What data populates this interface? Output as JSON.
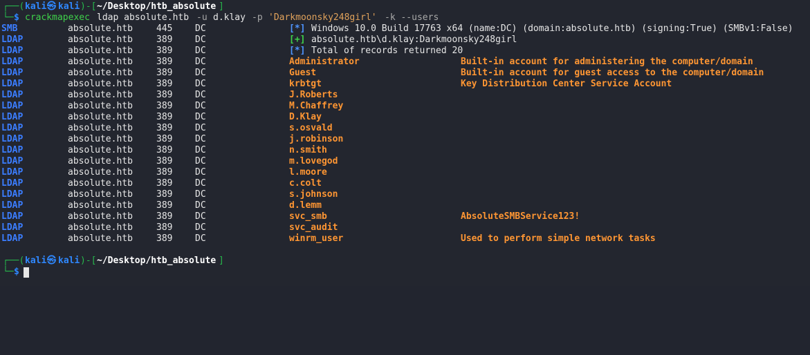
{
  "prompt": {
    "user": "kali",
    "at_symbol": "㉿",
    "host": "kali",
    "path": "~/Desktop/htb_absolute",
    "corner_top": "┌──(",
    "corner_bottom": "└─",
    "symbol": "$"
  },
  "command": {
    "program": "crackmapexec",
    "args_1": "ldap absolute.htb",
    "flag_u": "-u",
    "user_arg": "d.klay",
    "flag_p": "-p",
    "password_arg": "'Darkmoonsky248girl'",
    "flag_rest": "-k --users"
  },
  "output_rows": [
    {
      "proto": "SMB",
      "host": "absolute.htb",
      "port": "445",
      "name": "DC",
      "status": "[*]",
      "status_color": "blue",
      "message": "Windows 10.0 Build 17763 x64 (name:DC) (domain:absolute.htb) (signing:True) (SMBv1:False)",
      "desc": ""
    },
    {
      "proto": "LDAP",
      "host": "absolute.htb",
      "port": "389",
      "name": "DC",
      "status": "[+]",
      "status_color": "green",
      "message": "absolute.htb\\d.klay:Darkmoonsky248girl",
      "desc": ""
    },
    {
      "proto": "LDAP",
      "host": "absolute.htb",
      "port": "389",
      "name": "DC",
      "status": "[*]",
      "status_color": "blue",
      "message": "Total of records returned 20",
      "desc": ""
    },
    {
      "proto": "LDAP",
      "host": "absolute.htb",
      "port": "389",
      "name": "DC",
      "user": "Administrator",
      "desc": "Built-in account for administering the computer/domain"
    },
    {
      "proto": "LDAP",
      "host": "absolute.htb",
      "port": "389",
      "name": "DC",
      "user": "Guest",
      "desc": "Built-in account for guest access to the computer/domain"
    },
    {
      "proto": "LDAP",
      "host": "absolute.htb",
      "port": "389",
      "name": "DC",
      "user": "krbtgt",
      "desc": "Key Distribution Center Service Account"
    },
    {
      "proto": "LDAP",
      "host": "absolute.htb",
      "port": "389",
      "name": "DC",
      "user": "J.Roberts",
      "desc": ""
    },
    {
      "proto": "LDAP",
      "host": "absolute.htb",
      "port": "389",
      "name": "DC",
      "user": "M.Chaffrey",
      "desc": ""
    },
    {
      "proto": "LDAP",
      "host": "absolute.htb",
      "port": "389",
      "name": "DC",
      "user": "D.Klay",
      "desc": ""
    },
    {
      "proto": "LDAP",
      "host": "absolute.htb",
      "port": "389",
      "name": "DC",
      "user": "s.osvald",
      "desc": ""
    },
    {
      "proto": "LDAP",
      "host": "absolute.htb",
      "port": "389",
      "name": "DC",
      "user": "j.robinson",
      "desc": ""
    },
    {
      "proto": "LDAP",
      "host": "absolute.htb",
      "port": "389",
      "name": "DC",
      "user": "n.smith",
      "desc": ""
    },
    {
      "proto": "LDAP",
      "host": "absolute.htb",
      "port": "389",
      "name": "DC",
      "user": "m.lovegod",
      "desc": ""
    },
    {
      "proto": "LDAP",
      "host": "absolute.htb",
      "port": "389",
      "name": "DC",
      "user": "l.moore",
      "desc": ""
    },
    {
      "proto": "LDAP",
      "host": "absolute.htb",
      "port": "389",
      "name": "DC",
      "user": "c.colt",
      "desc": ""
    },
    {
      "proto": "LDAP",
      "host": "absolute.htb",
      "port": "389",
      "name": "DC",
      "user": "s.johnson",
      "desc": ""
    },
    {
      "proto": "LDAP",
      "host": "absolute.htb",
      "port": "389",
      "name": "DC",
      "user": "d.lemm",
      "desc": ""
    },
    {
      "proto": "LDAP",
      "host": "absolute.htb",
      "port": "389",
      "name": "DC",
      "user": "svc_smb",
      "desc": "AbsoluteSMBService123!"
    },
    {
      "proto": "LDAP",
      "host": "absolute.htb",
      "port": "389",
      "name": "DC",
      "user": "svc_audit",
      "desc": ""
    },
    {
      "proto": "LDAP",
      "host": "absolute.htb",
      "port": "389",
      "name": "DC",
      "user": "winrm_user",
      "desc": "Used to perform simple network tasks"
    }
  ],
  "colors": {
    "background": "#23262f",
    "proto": "#3b7dff",
    "user": "#ff9633",
    "status_plus": "#3fd14a",
    "status_star": "#4e94ff"
  }
}
